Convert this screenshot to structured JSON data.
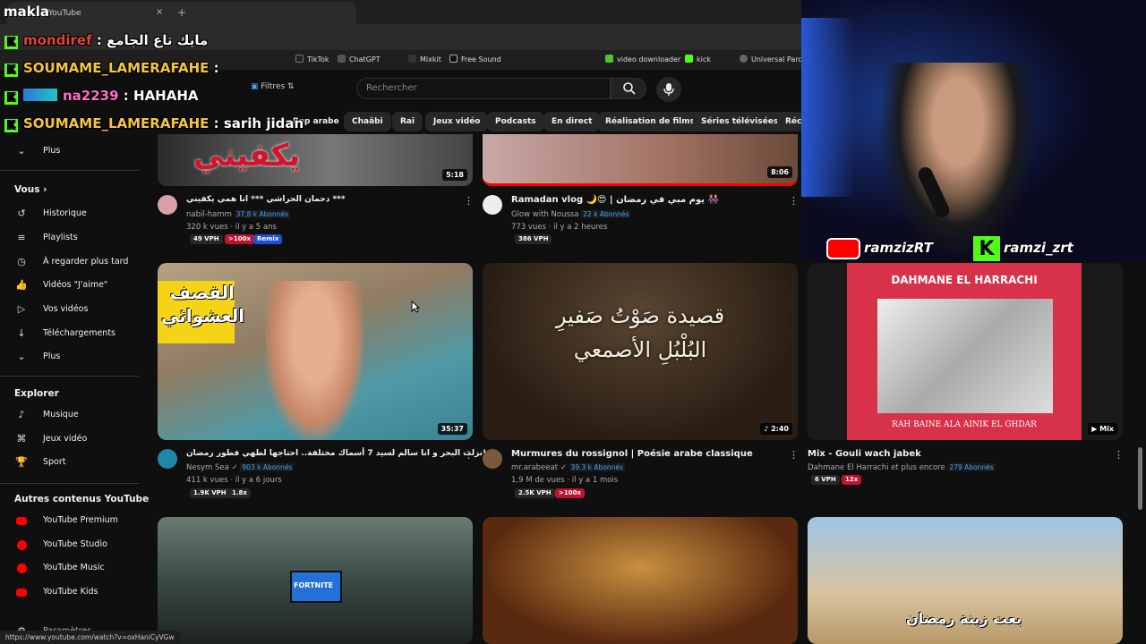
{
  "overlay": {
    "logo": "makla",
    "handles": {
      "youtube": "ramzizRT",
      "kick": "ramzi_zrt"
    }
  },
  "browser": {
    "tab_title": "YouTube",
    "close_glyph": "×",
    "new_tab_glyph": "+",
    "bookmarks": [
      {
        "label": "TikTok",
        "color": "#ffffff"
      },
      {
        "label": "ChatGPT",
        "color": "#aaaaaa"
      },
      {
        "label": "Mixkit",
        "color": "#dddddd"
      },
      {
        "label": "Free Sound",
        "color": "#ffffff"
      },
      {
        "label": "video downloader",
        "color": "#53c22b"
      },
      {
        "label": "kick",
        "color": "#53fc18"
      },
      {
        "label": "Universal Parcel",
        "color": "#dddddd"
      }
    ],
    "status_url": "https://www.youtube.com/watch?v=oxHaniCyVGw"
  },
  "yt_header": {
    "filters_label": "Filtres",
    "search_placeholder": "Rechercher"
  },
  "chips": [
    "Rap arabe",
    "Chaâbi",
    "Raï",
    "Jeux vidéo",
    "Podcasts",
    "En direct",
    "Réalisation de films",
    "Séries télévisées",
    "Réci"
  ],
  "sidebar": {
    "plus_top": "Plus",
    "you_section": "Vous",
    "you_items": [
      {
        "label": "Historique",
        "icon": "history-icon",
        "glyph": "↺"
      },
      {
        "label": "Playlists",
        "icon": "playlists-icon",
        "glyph": "≡"
      },
      {
        "label": "À regarder plus tard",
        "icon": "clock-icon",
        "glyph": "◷"
      },
      {
        "label": "Vidéos \"J'aime\"",
        "icon": "thumbs-up-icon",
        "glyph": "👍"
      },
      {
        "label": "Vos vidéos",
        "icon": "my-videos-icon",
        "glyph": "▷"
      },
      {
        "label": "Téléchargements",
        "icon": "download-icon",
        "glyph": "↓"
      },
      {
        "label": "Plus",
        "icon": "chevron-down-icon",
        "glyph": "⌄"
      }
    ],
    "explore_section": "Explorer",
    "explore_items": [
      {
        "label": "Musique",
        "icon": "music-icon",
        "glyph": "♪"
      },
      {
        "label": "Jeux vidéo",
        "icon": "gamepad-icon",
        "glyph": "⌘"
      },
      {
        "label": "Sport",
        "icon": "trophy-icon",
        "glyph": "🏆"
      }
    ],
    "other_section": "Autres contenus YouTube",
    "other_items": [
      {
        "label": "YouTube Premium",
        "icon": "youtube-premium-icon"
      },
      {
        "label": "YouTube Studio",
        "icon": "youtube-studio-icon"
      },
      {
        "label": "YouTube Music",
        "icon": "youtube-music-icon"
      },
      {
        "label": "YouTube Kids",
        "icon": "youtube-kids-icon"
      }
    ],
    "settings": "Paramètres"
  },
  "videos": {
    "row1": [
      {
        "title": "دحمان الحراشي *** انا همي يكفيني ***",
        "channel": "nabil-hamm",
        "subs": "37,8 k Abonnés",
        "meta": "320 k vues · il y a 5 ans",
        "duration": "5:18",
        "thumb_text": "يكفيني",
        "badges": [
          "49 VPH",
          ">100x",
          "Remix"
        ]
      },
      {
        "title": "Ramadan vlog 🌙😍 | يوم مبي في رمضان 👭",
        "channel": "Glow with Noussa",
        "subs": "22 k Abonnés",
        "meta": "773 vues · il y a 2 heures",
        "duration": "8:06",
        "badges": [
          "386 VPH"
        ]
      }
    ],
    "row2": [
      {
        "title": "نزلت البحر و انا سالم لسيد 7 أسماك مختلفة.. احتاجها لطهي فطور رمضان!",
        "channel": "Nesym Sea",
        "subs": "903 k Abonnés",
        "meta": "411 k vues · il y a 6 jours",
        "duration": "35:37",
        "thumb_text": "القصف العشوائي",
        "badges": [
          "1.9K VPH",
          "1.8x"
        ]
      },
      {
        "title": "Murmures du rossignol | Poésie arabe classique",
        "channel": "mr.arabeeat",
        "subs": "39,3 k Abonnés",
        "meta": "1,9 M de vues · il y a 1 mois",
        "duration": "2:40",
        "thumb_text": "قصيدة صَوْتُ صَفيرِ البُلْبُلِ الأصمعي",
        "badges": [
          "2.5K VPH",
          ">100x"
        ]
      },
      {
        "title": "Mix - Gouli wach jabek",
        "channel": "Dahmane El Harrachi et plus encore",
        "subs": "279 Abonnés",
        "meta": "",
        "duration": "Mix",
        "thumb_top": "DAHMANE EL HARRACHI",
        "thumb_bottom": "RAH BAINE ALA AINIK EL GHDAR",
        "badges": [
          "6 VPH",
          "12x"
        ]
      }
    ],
    "row3": [
      {
        "thumb_text": "FORTNITE"
      },
      {
        "thumb_text": ""
      },
      {
        "thumb_text": "بعت زينة رمضان"
      }
    ]
  },
  "chat": [
    {
      "user": "mondiref",
      "message": "مايك تاع الجامع",
      "user_color": "#e0433a"
    },
    {
      "user": "SOUMAME_LAMERAFAHE",
      "message": "",
      "user_color": "#f5c542"
    },
    {
      "user": "na2239",
      "message": "HAHAHA",
      "user_color": "#ff6ec7"
    },
    {
      "user": "SOUMAME_LAMERAFAHE",
      "message": "sarih jidan",
      "user_color": "#f5c542"
    }
  ]
}
